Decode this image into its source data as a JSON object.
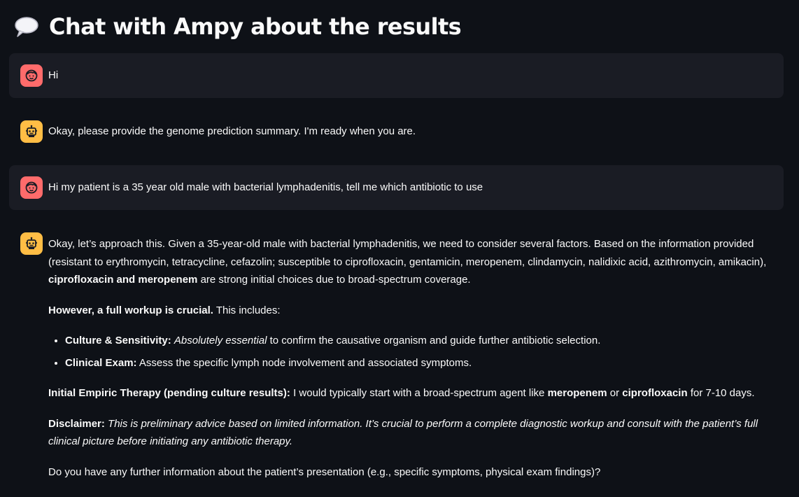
{
  "header": {
    "emoji_icon": "speech-balloon-icon",
    "title": "Chat with Ampy about the results"
  },
  "colors": {
    "background": "#0e1117",
    "user_bubble": "#1a1c24",
    "user_avatar": "#ff6b6b",
    "bot_avatar": "#ffbd45",
    "text": "#fafafa"
  },
  "messages": [
    {
      "role": "user",
      "avatar_icon": "user-face-icon",
      "text": "Hi"
    },
    {
      "role": "assistant",
      "avatar_icon": "robot-icon",
      "text": "Okay, please provide the genome prediction summary. I'm ready when you are."
    },
    {
      "role": "user",
      "avatar_icon": "user-face-icon",
      "text": "Hi my patient is a 35 year old male with bacterial lymphadenitis, tell me which antibiotic to use"
    },
    {
      "role": "assistant",
      "avatar_icon": "robot-icon",
      "p1_text": "Okay, let’s approach this. Given a 35-year-old male with bacterial lymphadenitis, we need to consider several factors. Based on the information provided (resistant to erythromycin, tetracycline, cefazolin; susceptible to ciprofloxacin, gentamicin, meropenem, clindamycin, nalidixic acid, azithromycin, amikacin),",
      "p1_bold": "ciprofloxacin and meropenem",
      "p1_tail": "are strong initial choices due to broad-spectrum coverage.",
      "p2_bold": "However, a full workup is crucial.",
      "p2_tail": "This includes:",
      "bullets": [
        {
          "bold": "Culture & Sensitivity:",
          "italic": "Absolutely essential",
          "tail": "to confirm the causative organism and guide further antibiotic selection."
        },
        {
          "bold": "Clinical Exam:",
          "italic": "",
          "tail": "Assess the specific lymph node involvement and associated symptoms."
        }
      ],
      "p3_bold": "Initial Empiric Therapy (pending culture results):",
      "p3_text": "I would typically start with a broad-spectrum agent like",
      "p3_bold2": "meropenem",
      "p3_or": "or",
      "p3_bold3": "ciprofloxacin",
      "p3_tail": "for 7-10 days.",
      "p4_bold": "Disclaimer:",
      "p4_italic": "This is preliminary advice based on limited information. It’s crucial to perform a complete diagnostic workup and consult with the patient’s full clinical picture before initiating any antibiotic therapy.",
      "p5_text": "Do you have any further information about the patient’s presentation (e.g., specific symptoms, physical exam findings)?"
    }
  ]
}
